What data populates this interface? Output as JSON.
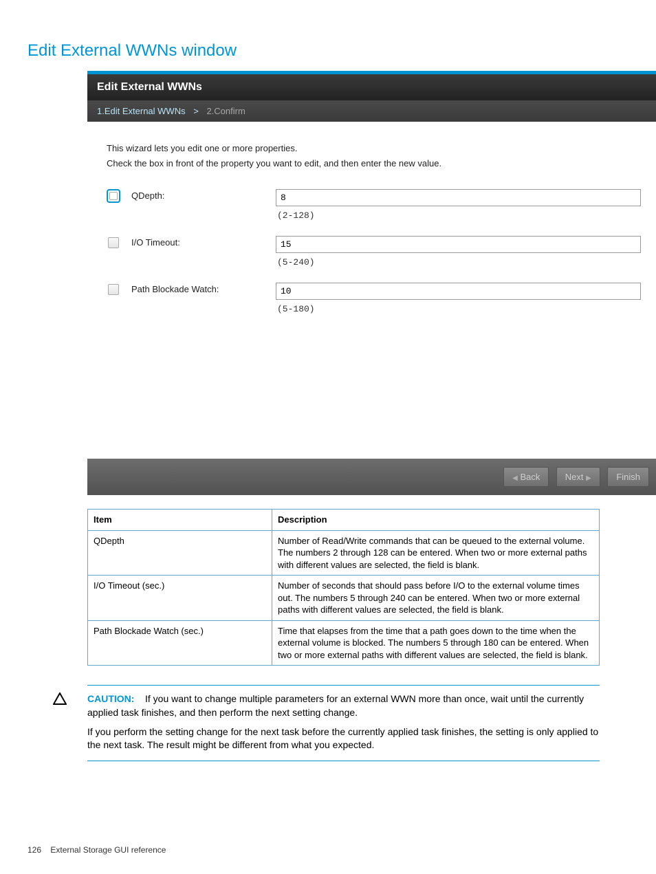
{
  "page": {
    "title": "Edit External WWNs window",
    "footer_page": "126",
    "footer_text": "External Storage GUI reference"
  },
  "wizard": {
    "title": "Edit External WWNs",
    "steps": {
      "s1": "1.Edit External WWNs",
      "sep": ">",
      "s2": "2.Confirm"
    },
    "intro1": "This wizard lets you edit one or more properties.",
    "intro2": "Check the box in front of the property you want to edit, and then enter the new value.",
    "fields": {
      "qdepth": {
        "label": "QDepth:",
        "value": "8",
        "range": "(2-128)"
      },
      "iotimeout": {
        "label": "I/O Timeout:",
        "value": "15",
        "range": "(5-240)"
      },
      "pathblockade": {
        "label": "Path Blockade Watch:",
        "value": "10",
        "range": "(5-180)"
      }
    },
    "buttons": {
      "back": "Back",
      "next": "Next",
      "finish": "Finish"
    }
  },
  "table": {
    "h1": "Item",
    "h2": "Description",
    "rows": [
      {
        "item": "QDepth",
        "desc": "Number of Read/Write commands that can be queued to the external volume. The numbers 2 through 128 can be entered. When two or more external paths with different values are selected, the field is blank."
      },
      {
        "item": "I/O Timeout (sec.)",
        "desc": "Number of seconds that should pass before I/O to the external volume times out. The numbers 5 through 240 can be entered. When two or more external paths with different values are selected, the field is blank."
      },
      {
        "item": "Path Blockade Watch (sec.)",
        "desc": "Time that elapses from the time that a path goes down to the time when the external volume is blocked. The numbers 5 through 180 can be entered. When two or more external paths with different values are selected, the field is blank."
      }
    ]
  },
  "caution": {
    "label": "CAUTION:",
    "p1a": "If you want to change multiple parameters for an external WWN more than once, wait until the currently applied task finishes, and then perform the next setting change.",
    "p2": "If you perform the setting change for the next task before the currently applied task finishes, the setting is only applied to the next task. The result might be different from what you expected."
  }
}
